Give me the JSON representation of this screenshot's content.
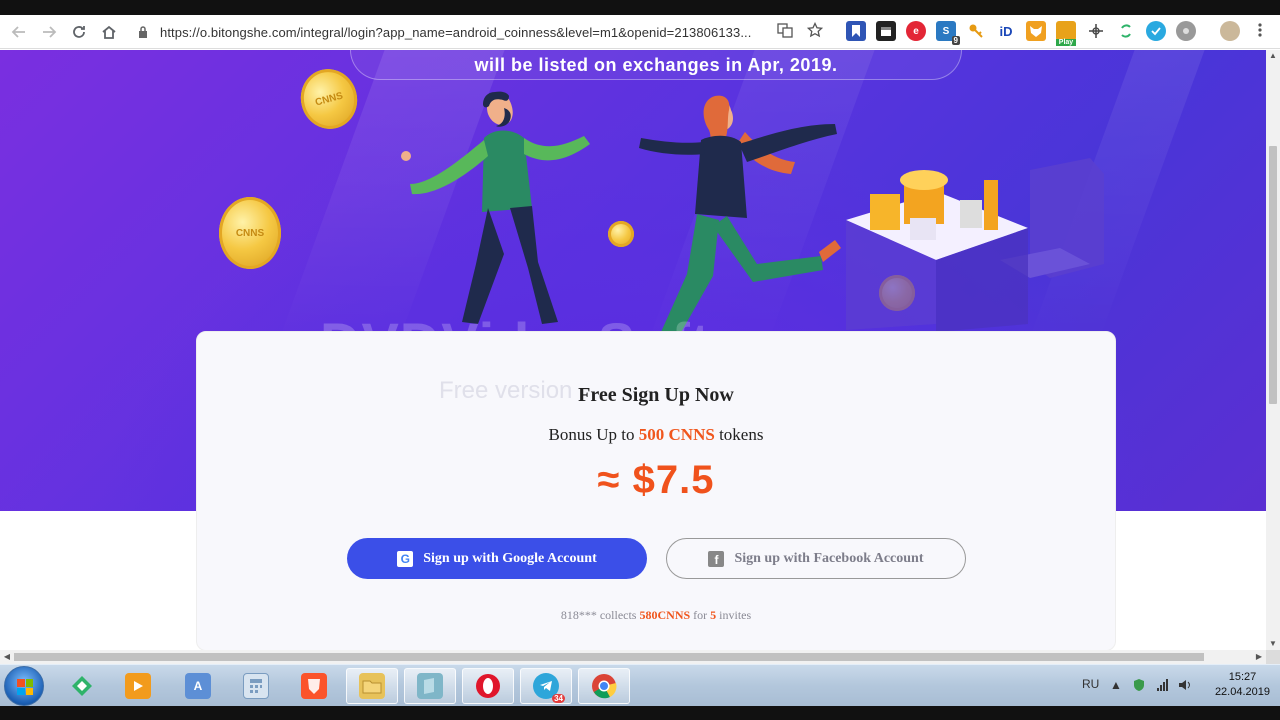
{
  "browser": {
    "url": "https://o.bitongshe.com/integral/login?app_name=android_coinness&level=m1&openid=213806133...",
    "back_icon": "arrow-left-icon",
    "forward_icon": "arrow-right-icon",
    "reload_icon": "reload-icon",
    "home_icon": "home-icon",
    "ext_badge_count": "9",
    "ext_play_label": "Play"
  },
  "hero": {
    "announcement": "will be listed on exchanges in Apr, 2019.",
    "coin_label": "CNNS"
  },
  "watermark": {
    "brand": "DVDVideoSoft.com",
    "edition": "Free version"
  },
  "signup": {
    "title": "Free Sign Up Now",
    "bonus_prefix": "Bonus Up to",
    "bonus_amount": "500 CNNS",
    "bonus_suffix": "tokens",
    "price": "≈ $7.5",
    "google_button": "Sign up with Google Account",
    "facebook_button": "Sign up with Facebook Account",
    "collects_user": "818***",
    "collects_word": "collects",
    "collects_amount": "580CNNS",
    "collects_for": "for",
    "collects_count": "5",
    "collects_invites": "invites"
  },
  "taskbar": {
    "language": "RU",
    "time": "15:27",
    "date": "22.04.2019",
    "telegram_badge": "34"
  },
  "colors": {
    "accent_orange": "#f0561d",
    "google_button": "#3b4fe8",
    "hero_purple": "#5a33df"
  }
}
